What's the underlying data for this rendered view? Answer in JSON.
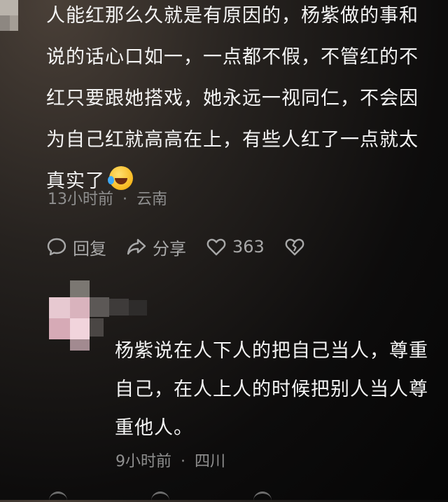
{
  "comment1": {
    "lines": [
      "人能红那么久就是有原因的，杨紫做的事和",
      "说的话心口如一，一点都不假，不管红的不",
      "红只要跟她搭戏，她永远一视同仁，不会因",
      "为自己红就高高在上，有些人红了一点就太",
      "真实了"
    ],
    "emoji": "laughing-crying-emoji",
    "time": "13小时前",
    "sep": "·",
    "location": "云南",
    "actions": {
      "reply_label": "回复",
      "share_label": "分享",
      "like_count": "363"
    }
  },
  "reply1": {
    "lines": [
      "杨紫说在人下人的把自己当人，尊重",
      "自己，在人上人的时候把别人当人尊",
      "重他人。"
    ],
    "time": "9小时前",
    "sep": "·",
    "location": "四川"
  },
  "icons": {
    "reply": "comment-bubble-icon",
    "share": "share-arrow-icon",
    "like": "heart-icon",
    "dislike": "broken-heart-icon"
  },
  "colors": {
    "text": "#f4f4f4",
    "meta": "#8f8f8f",
    "action": "#a8a8a8"
  }
}
